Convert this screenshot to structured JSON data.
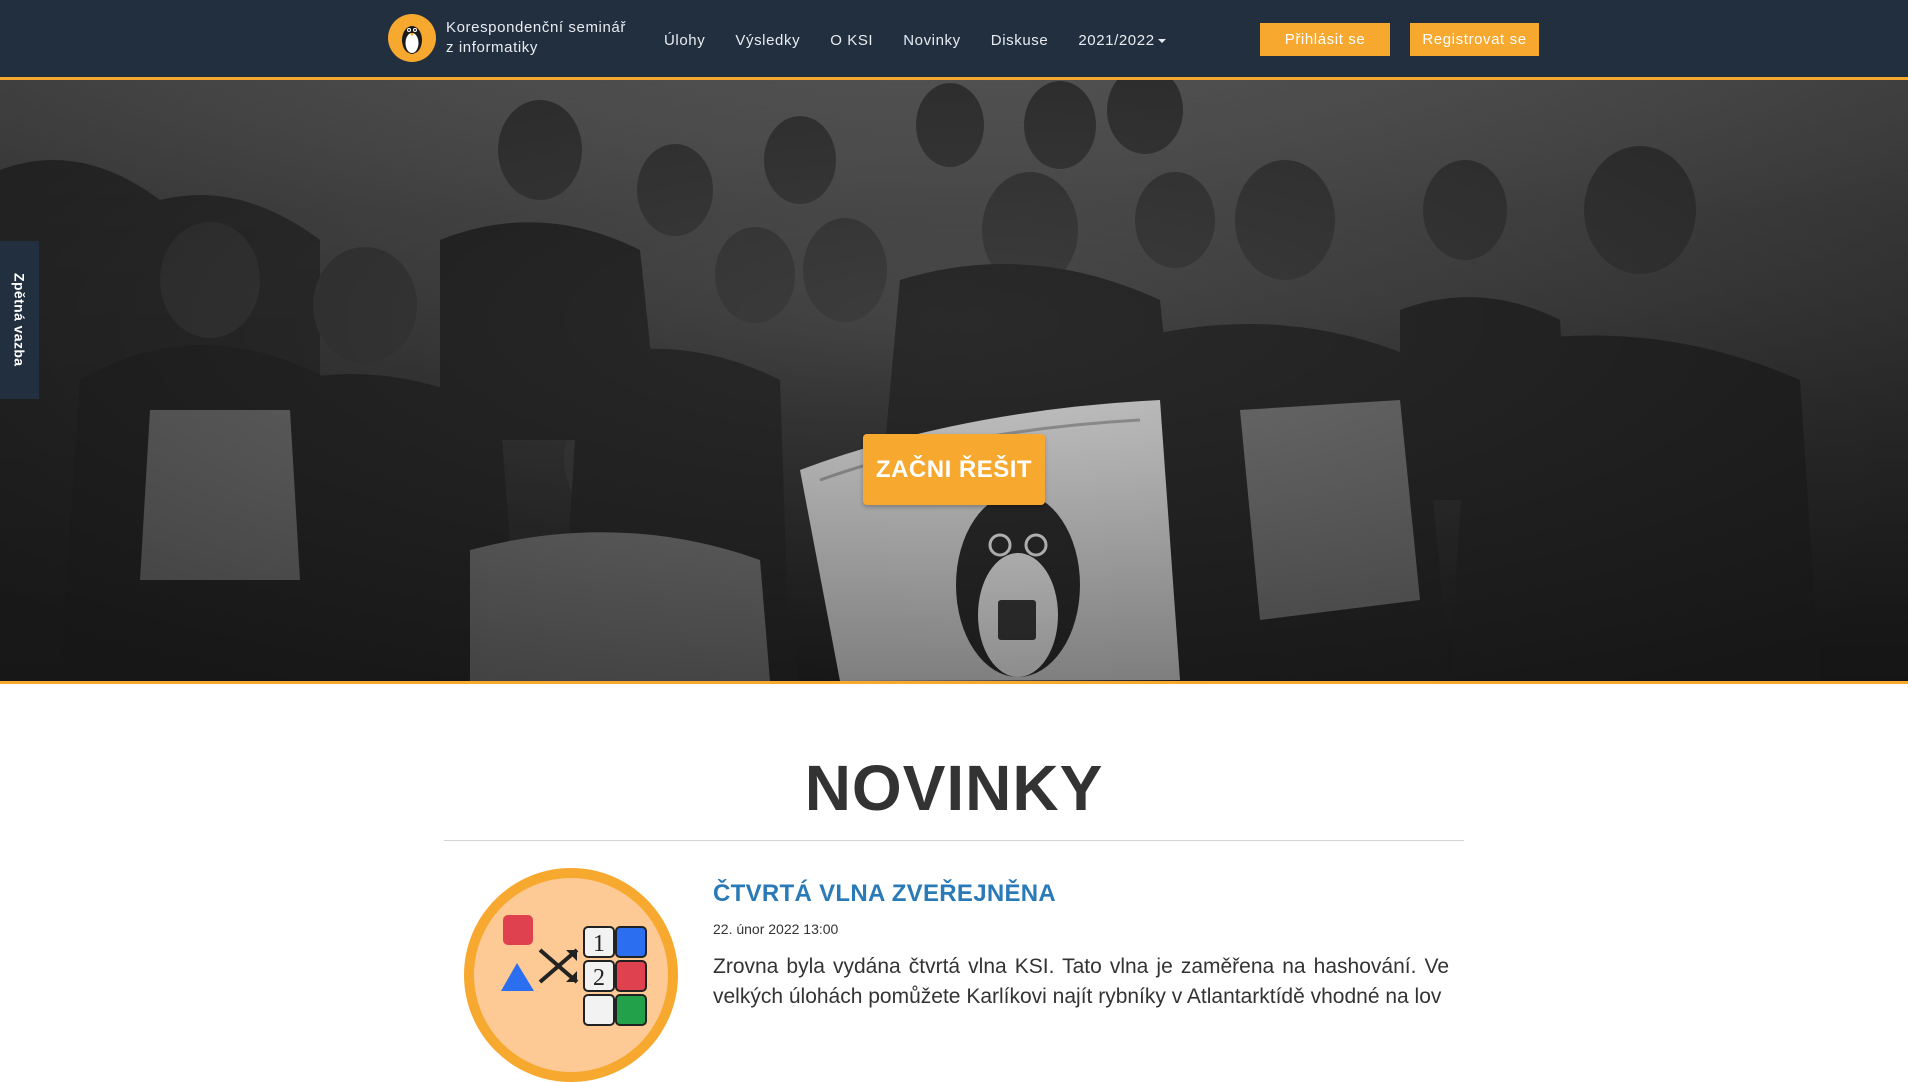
{
  "colors": {
    "accent": "#f7a82f",
    "navbar_bg": "#222f3f",
    "link": "#2a7ab8"
  },
  "brand": {
    "line1": "Korespondenční seminář",
    "line2": "z informatiky",
    "logo_icon": "penguin-icon"
  },
  "nav": {
    "items": [
      {
        "label": "Úlohy"
      },
      {
        "label": "Výsledky"
      },
      {
        "label": "O KSI"
      },
      {
        "label": "Novinky"
      },
      {
        "label": "Diskuse"
      }
    ],
    "year": "2021/2022",
    "login": "Přihlásit se",
    "register": "Registrovat se"
  },
  "hero": {
    "cta": "ZAČNI ŘEŠIT"
  },
  "feedback": {
    "label": "Zpětná vazba"
  },
  "news": {
    "heading": "NOVINKY",
    "items": [
      {
        "title": "ČTVRTÁ VLNA ZVEŘEJNĚNA",
        "date": "22. únor 2022 13:00",
        "text": "Zrovna byla vydána čtvrtá vlna KSI. Tato vlna je zaměřena na hashování. Ve velkých úlohách pomůžete Karlíkovi najít rybníky v Atlantarktídě vhodné na lov",
        "thumb_icon": "hashing-illustration-icon",
        "thumb_digits": [
          "1",
          "2"
        ]
      }
    ]
  }
}
